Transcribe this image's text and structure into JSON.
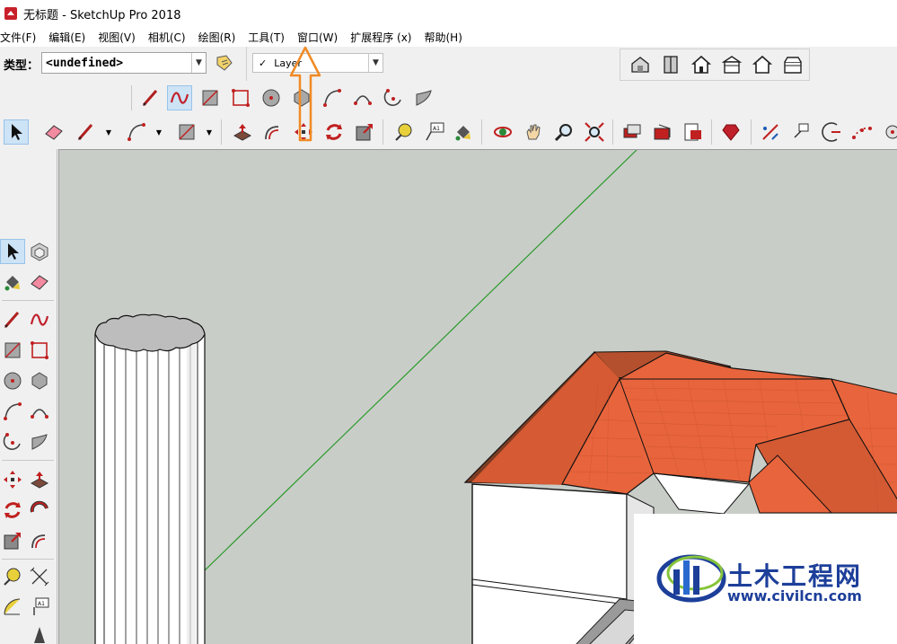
{
  "window": {
    "title": "无标题 - SketchUp Pro 2018"
  },
  "menu": [
    "文件(F)",
    "编辑(E)",
    "视图(V)",
    "相机(C)",
    "绘图(R)",
    "工具(T)",
    "窗口(W)",
    "扩展程序 (x)",
    "帮助(H)"
  ],
  "toolbar": {
    "type_label": "类型：",
    "type_value": "<undefined>",
    "layer_check": "✓",
    "layer_value": "Layer"
  },
  "watermark": {
    "title": "土木工程网",
    "url": "www.civilcn.com"
  },
  "colors": {
    "viewport_bg": "#c9cdc8",
    "roof": "#e8643c",
    "roof_dark": "#7a3a22",
    "annotation": "#f08a24",
    "axis_green": "#2a9a2a",
    "logo_blue": "#1d3f9a"
  },
  "icons": {
    "draw_row": [
      "line-icon",
      "freehand-icon",
      "rectangle-icon",
      "rotated-rectangle-icon",
      "circle-icon",
      "polygon-icon",
      "arc-icon",
      "2pt-arc-icon",
      "3pt-arc-icon",
      "pie-icon"
    ],
    "main_row": [
      "select-icon",
      "eraser-icon",
      "pencil-icon",
      "arc-icon",
      "rectangle-icon",
      "push-pull-icon",
      "offset-icon",
      "move-icon",
      "rotate-icon",
      "scale-icon",
      "tape-measure-icon",
      "text-icon",
      "paint-bucket-icon",
      "orbit-icon",
      "pan-icon",
      "zoom-icon",
      "zoom-extents-icon",
      "warehouse-icon",
      "extension-warehouse-icon",
      "layout-icon",
      "ruby-icon",
      "section-icon",
      "dimension-icon",
      "protractor-icon",
      "axes-icon"
    ],
    "views": [
      "iso-view-icon",
      "top-view-icon",
      "front-view-icon",
      "right-view-icon",
      "back-view-icon",
      "left-view-icon"
    ]
  }
}
